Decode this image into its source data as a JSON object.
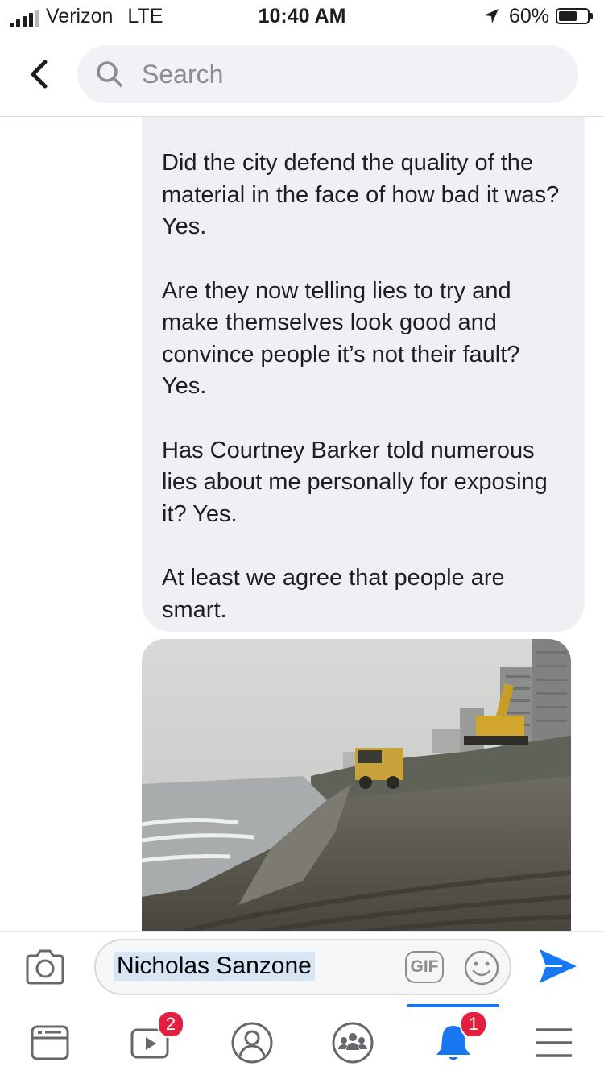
{
  "status_bar": {
    "carrier": "Verizon",
    "network": "LTE",
    "time": "10:40 AM",
    "battery": "60%",
    "battery_level": 0.6,
    "location_icon": "location-arrow-icon"
  },
  "header": {
    "back_icon": "chevron-left-icon",
    "search_icon": "search-icon",
    "search_placeholder": "Search"
  },
  "message": {
    "paragraphs": [
      "Did the city defend the quality of the material in the face of how bad it was? Yes.",
      "Are they now telling lies to try and make themselves look good and convince people it’s not their fault? Yes.",
      "Has Courtney Barker told numerous lies about me personally for exposing it? Yes.",
      "At least we agree that people are smart."
    ],
    "bubble_color": "#eef0f3"
  },
  "composer": {
    "camera_icon": "camera-icon",
    "text": "Nicholas Sanzone",
    "gif_label": "GIF",
    "emoji_icon": "smiley-icon",
    "send_icon": "send-icon"
  },
  "bottom_nav": {
    "items": [
      {
        "name": "news-feed-icon",
        "badge": ""
      },
      {
        "name": "watch-icon",
        "badge": "2"
      },
      {
        "name": "profile-icon",
        "badge": ""
      },
      {
        "name": "groups-icon",
        "badge": ""
      },
      {
        "name": "notifications-icon",
        "badge": "1"
      },
      {
        "name": "menu-icon",
        "badge": ""
      }
    ],
    "active_tab": "notifications",
    "accent": "#1877f2",
    "badge_color": "#e41e3f"
  }
}
